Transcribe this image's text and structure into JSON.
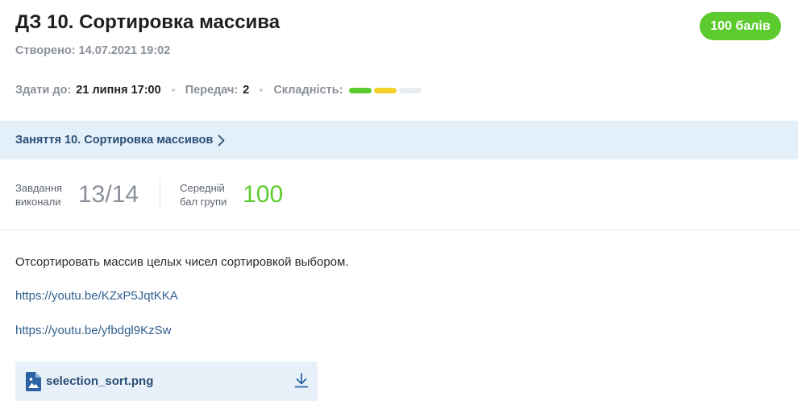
{
  "header": {
    "title": "ДЗ 10. Сортировка массива",
    "score_badge": "100 балів",
    "created": "Створено: 14.07.2021 19:02"
  },
  "meta": {
    "deadline_label": "Здати до:",
    "deadline_value": "21 липня 17:00",
    "retakes_label": "Передач:",
    "retakes_value": "2",
    "difficulty_label": "Складність:",
    "difficulty_level": 2,
    "difficulty_max": 3,
    "difficulty_colors": [
      "#5ccb2e",
      "#f5d02b",
      "#e9edf1"
    ]
  },
  "lesson": {
    "link_label": "Заняття 10. Сортировка массивов",
    "icon": "chevron-right-icon"
  },
  "stats": {
    "completed_label_line1": "Завдання",
    "completed_label_line2": "виконали",
    "completed_value": "13/14",
    "completed_color": "#8a9099",
    "avg_label_line1": "Середній",
    "avg_label_line2": "бал групи",
    "avg_value": "100",
    "avg_color": "#5ccb2e"
  },
  "content": {
    "description": "Отсортировать массив целых чисел сортировкой выбором.",
    "links": [
      "https://youtu.be/KZxP5JqtKKA",
      "https://youtu.be/yfbdgl9KzSw"
    ]
  },
  "attachment": {
    "file_name": "selection_sort.png",
    "file_icon": "image-file-icon",
    "action_icon": "download-icon"
  }
}
